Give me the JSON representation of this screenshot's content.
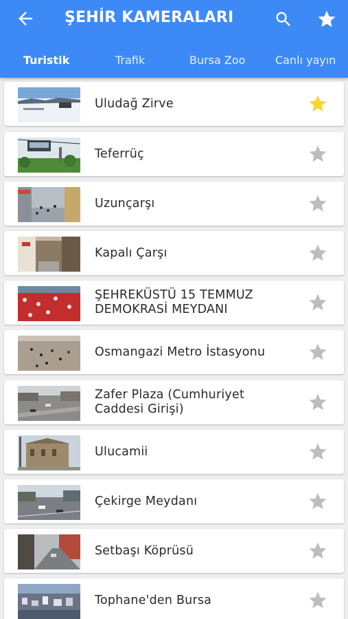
{
  "app_bar": {
    "title": "ŞEHİR KAMERALARI",
    "icons": [
      "back-arrow-icon",
      "search-icon",
      "star-icon"
    ]
  },
  "tabs": [
    {
      "label": "Turistik",
      "selected": true
    },
    {
      "label": "Trafik",
      "selected": false
    },
    {
      "label": "Bursa Zoo",
      "selected": false
    },
    {
      "label": "Canlı yayın",
      "selected": false
    }
  ],
  "colors": {
    "primary": "#3d8af7",
    "favorite_star": "#f7d736",
    "unfavorite_star": "#bdbdbd"
  },
  "cameras": [
    {
      "name_lines": [
        "Uludağ Zirve"
      ],
      "favorite": true
    },
    {
      "name_lines": [
        "Teferrüç"
      ],
      "favorite": false
    },
    {
      "name_lines": [
        "Uzunçarşı"
      ],
      "favorite": false
    },
    {
      "name_lines": [
        "Kapalı Çarşı"
      ],
      "favorite": false
    },
    {
      "name_lines": [
        "ŞEHREKÜSTÜ 15 TEMMUZ",
        "DEMOKRASİ MEYDANI"
      ],
      "favorite": false
    },
    {
      "name_lines": [
        "Osmangazi Metro İstasyonu"
      ],
      "favorite": false
    },
    {
      "name_lines": [
        "Zafer Plaza (Cumhuriyet",
        "Caddesi Girişi)"
      ],
      "favorite": false
    },
    {
      "name_lines": [
        "Ulucamii"
      ],
      "favorite": false
    },
    {
      "name_lines": [
        "Çekirge Meydanı"
      ],
      "favorite": false
    },
    {
      "name_lines": [
        "Setbaşı Köprüsü"
      ],
      "favorite": false
    },
    {
      "name_lines": [
        "Tophane'den Bursa"
      ],
      "favorite": false
    }
  ]
}
